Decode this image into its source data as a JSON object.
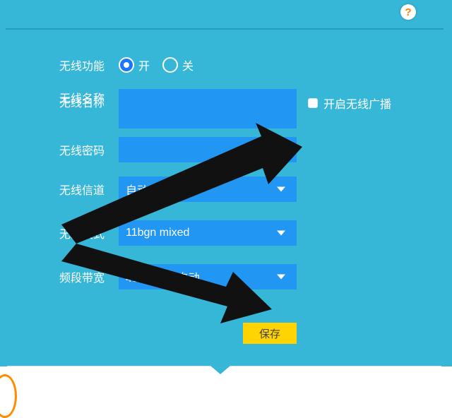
{
  "help_icon_char": "?",
  "form": {
    "wireless_enable": {
      "label": "无线功能",
      "option_on": "开",
      "option_off": "关",
      "value": "on"
    },
    "ssid": {
      "label": "无线名称",
      "value": ""
    },
    "broadcast": {
      "checkbox_label": "开启无线广播",
      "checked": false
    },
    "password": {
      "label": "无线密码",
      "value": ""
    },
    "channel": {
      "label": "无线信道",
      "value": "自动"
    },
    "mode": {
      "label": "无线模式",
      "value": "11bgn mixed"
    },
    "bandwidth": {
      "label": "频段带宽",
      "value": "40/20MHz自动"
    },
    "save_button": "保存"
  },
  "colors": {
    "panel_bg": "#36b7d7",
    "input_bg": "#2196f3",
    "save_bg": "#ffd400",
    "arrow": "#111111"
  }
}
